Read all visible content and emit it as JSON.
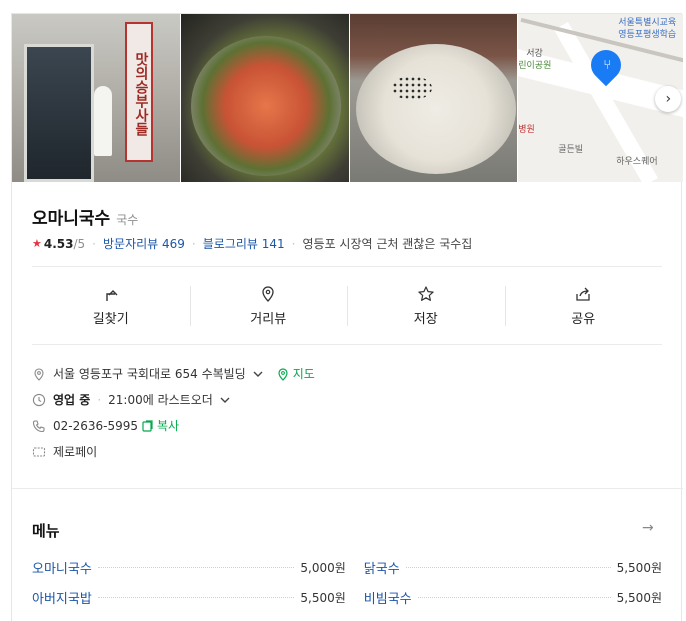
{
  "photos": {
    "p1_banner": "맛의승부사들",
    "map_labels": [
      "서울특별시교육",
      "영등포평생학습",
      "서강",
      "린이공원",
      "병원",
      "골든빌",
      "하우스퀘어"
    ]
  },
  "place": {
    "name": "오마니국수",
    "category": "국수",
    "rating": "4.53",
    "rating_max": "/5",
    "visitor_reviews": "방문자리뷰 469",
    "blog_reviews": "블로그리뷰 141",
    "description": "영등포 시장역 근처 괜찮은 국수집"
  },
  "actions": [
    {
      "label": "길찾기",
      "icon": "directions-icon"
    },
    {
      "label": "거리뷰",
      "icon": "streetview-icon"
    },
    {
      "label": "저장",
      "icon": "star-icon"
    },
    {
      "label": "공유",
      "icon": "share-icon"
    }
  ],
  "info": {
    "address": "서울 영등포구 국회대로 654 수복빌딩",
    "map_link": "지도",
    "status": "영업 중",
    "hours": "21:00에 라스트오더",
    "phone": "02-2636-5995",
    "copy": "복사",
    "payment": "제로페이"
  },
  "menu": {
    "title": "메뉴",
    "items": [
      {
        "name": "오마니국수",
        "price": "5,000원"
      },
      {
        "name": "닭국수",
        "price": "5,500원"
      },
      {
        "name": "아버지국밥",
        "price": "5,500원"
      },
      {
        "name": "비빔국수",
        "price": "5,500원"
      }
    ]
  },
  "colors": {
    "link": "#1b56a8",
    "green": "#03a94d",
    "star": "#e4343f",
    "pin": "#1a7cf5"
  }
}
